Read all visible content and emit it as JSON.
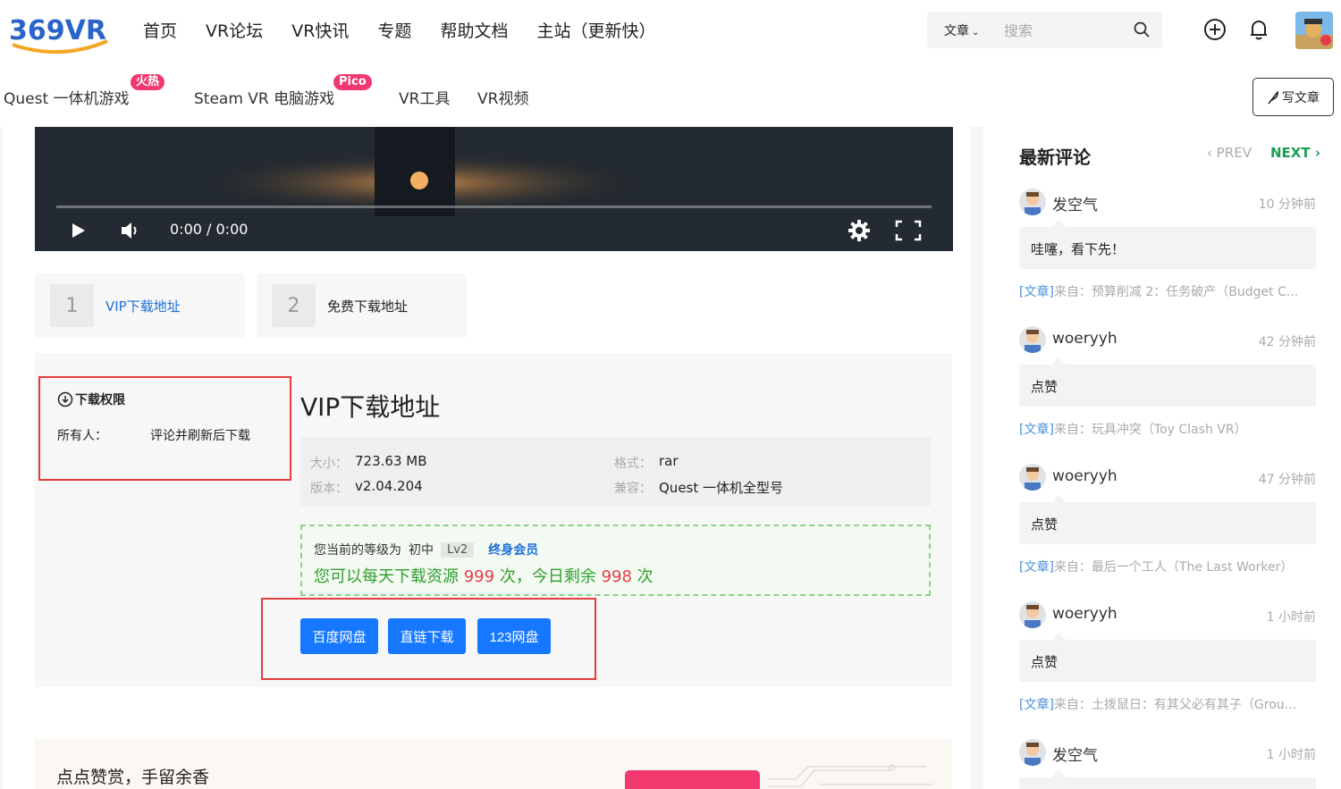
{
  "header": {
    "logo_text": "369VR",
    "nav": [
      "首页",
      "VR论坛",
      "VR快讯",
      "专题",
      "帮助文档",
      "主站（更新快）"
    ],
    "search": {
      "category": "文章",
      "placeholder": "搜索"
    },
    "sub_nav": [
      {
        "label": "Quest 一体机游戏",
        "badge": "火热"
      },
      {
        "label": "Steam VR 电脑游戏",
        "badge": "Pico"
      },
      {
        "label": "VR工具",
        "badge": ""
      },
      {
        "label": "VR视频",
        "badge": ""
      }
    ],
    "write_label": "写文章"
  },
  "video": {
    "time": "0:00 / 0:00"
  },
  "tabs": [
    {
      "num": "1",
      "label": "VIP下载地址",
      "color": "#1e6fd9"
    },
    {
      "num": "2",
      "label": "免费下载地址",
      "color": "#222222"
    }
  ],
  "permission": {
    "title": "下载权限",
    "owner_label": "所有人：",
    "owner_value": "评论并刷新后下载"
  },
  "download": {
    "title": "VIP下载地址",
    "size_label": "大小：",
    "size": "723.63 MB",
    "version_label": "版本：",
    "version": "v2.04.204",
    "format_label": "格式：",
    "format": "rar",
    "compat_label": "兼容：",
    "compat": "Quest 一体机全型号",
    "level_prefix": "您当前的等级为",
    "level_name": "初中",
    "level_badge": "Lv2",
    "lifetime": "终身会员",
    "quota_text_1": "您可以每天下载资源",
    "quota_total": "999",
    "quota_text_2": "次，今日剩余",
    "quota_left": "998",
    "quota_text_3": "次",
    "buttons": [
      "百度网盘",
      "直链下载",
      "123网盘"
    ]
  },
  "reward": {
    "text": "点点赞赏，手留余香"
  },
  "sidebar": {
    "title": "最新评论",
    "prev": "PREV",
    "next": "NEXT",
    "comments": [
      {
        "name": "发空气",
        "time": "10 分钟前",
        "text": "哇噻，看下先！",
        "tag": "[文章]",
        "src": "来自：预算削减 2：任务破产（Budget C..."
      },
      {
        "name": "woeryyh",
        "time": "42 分钟前",
        "text": "点赞",
        "tag": "[文章]",
        "src": "来自：玩具冲突（Toy Clash VR）"
      },
      {
        "name": "woeryyh",
        "time": "47 分钟前",
        "text": "点赞",
        "tag": "[文章]",
        "src": "来自：最后一个工人（The Last Worker）"
      },
      {
        "name": "woeryyh",
        "time": "1 小时前",
        "text": "点赞",
        "tag": "[文章]",
        "src": "来自：土拨鼠日：有其父必有其子（Grou..."
      },
      {
        "name": "发空气",
        "time": "1 小时前",
        "text": "",
        "tag": "",
        "src": ""
      }
    ]
  }
}
